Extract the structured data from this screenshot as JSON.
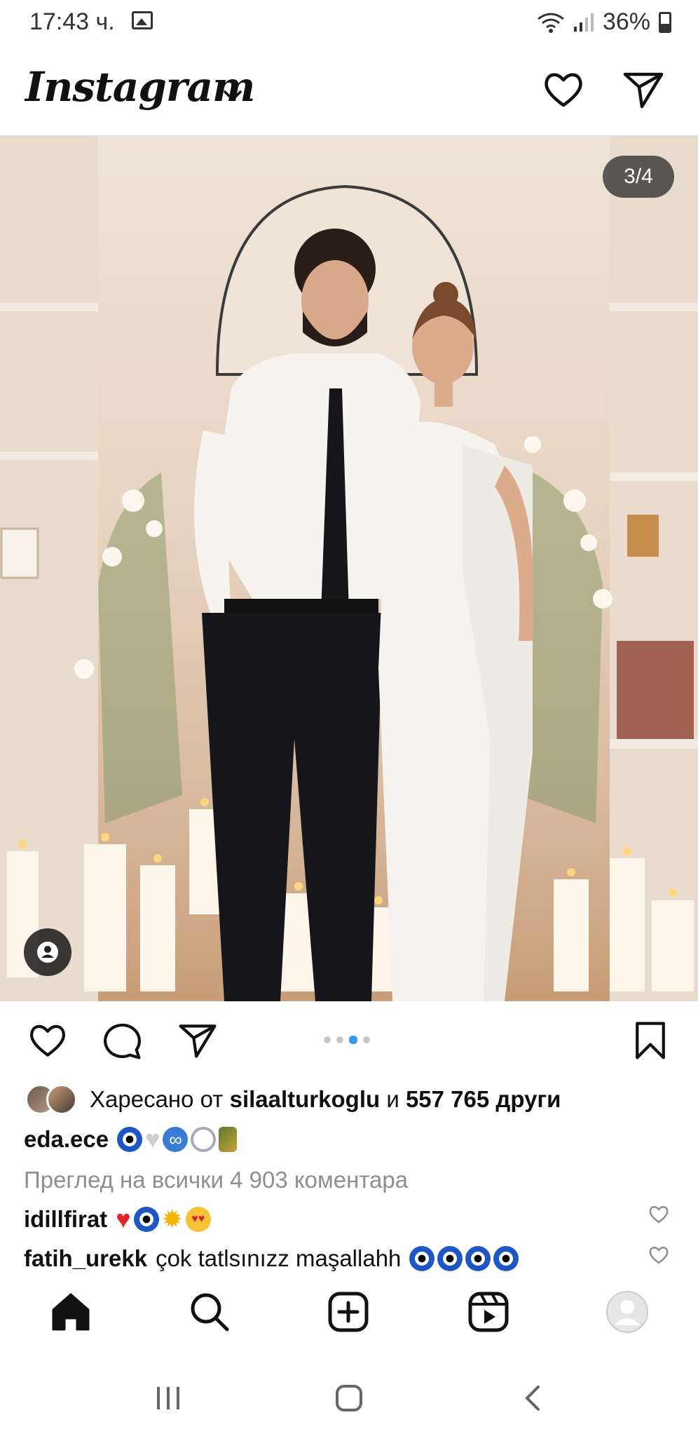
{
  "status": {
    "time": "17:43 ч.",
    "battery": "36%"
  },
  "header": {
    "logo": "Instagram"
  },
  "post": {
    "counter": "3/4",
    "likes_prefix": "Харесано от ",
    "likes_user": "silaalturkoglu",
    "likes_and": " и ",
    "likes_count": "557 765 други",
    "author": "eda.ece",
    "view_comments": "Преглед на всички 4 903 коментара",
    "comments": [
      {
        "user": "idillfirat",
        "text": ""
      },
      {
        "user": "fatih_urekk",
        "text": "çok tatlsınızz maşallahh"
      }
    ]
  },
  "colors": {
    "accent": "#3897f0",
    "text": "#111111",
    "secondary": "#8e8e8e"
  },
  "icons": [
    "image-icon",
    "wifi-icon",
    "signal-icon",
    "battery-icon",
    "chevron-down-icon",
    "heart-icon",
    "send-icon",
    "user-tag-icon",
    "like-icon",
    "comment-icon",
    "share-icon",
    "bookmark-icon",
    "home-icon",
    "search-icon",
    "create-icon",
    "reels-icon",
    "profile-icon"
  ]
}
